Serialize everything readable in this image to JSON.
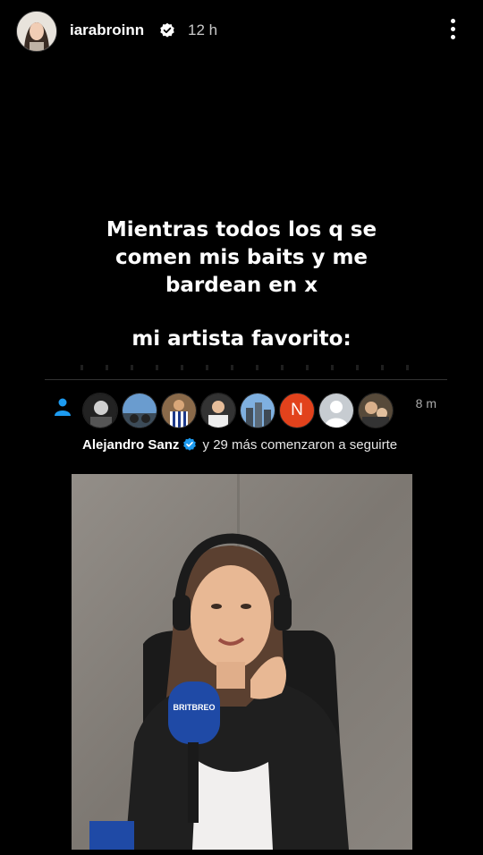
{
  "story": {
    "username": "iarabroinn",
    "time": "12 h",
    "caption_lines": [
      "Mientras todos los q se",
      "comen mis baits y me",
      "bardean en x"
    ],
    "caption_second": "mi artista favorito:"
  },
  "notification": {
    "time": "8 m",
    "name": "Alejandro Sanz",
    "rest": "y 29 más comenzaron a seguirte",
    "avatars": [
      "avatar-1",
      "avatar-2",
      "avatar-3",
      "avatar-4",
      "avatar-5",
      "avatar-n",
      "avatar-7",
      "avatar-8"
    ],
    "avatar_letter": "N"
  },
  "photo": {
    "mic_label": "BRITBREO"
  },
  "colors": {
    "verified": "#0095f6",
    "accent": "#1d9bf0",
    "n_avatar": "#e2421c"
  }
}
